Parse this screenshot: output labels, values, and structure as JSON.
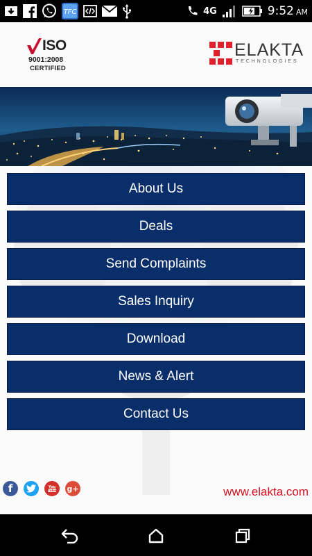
{
  "status_bar": {
    "time": "9:52",
    "ampm": "AM",
    "network": "4G",
    "left_icons": [
      "download-icon",
      "facebook-icon",
      "whatsapp-icon",
      "tfc-app-icon",
      "code-icon",
      "mail-icon",
      "usb-icon"
    ],
    "right_icons": [
      "phone-icon",
      "signal-icon",
      "battery-icon"
    ]
  },
  "header": {
    "iso_logo": {
      "word": "ISO",
      "standard": "9001:2008",
      "certified": "CERTIFIED"
    },
    "brand_logo": {
      "name": "ELAKTA",
      "tagline": "TECHNOLOGIES"
    }
  },
  "banner": {
    "icons": [
      "city-night-image",
      "cctv-camera-image"
    ]
  },
  "menu": {
    "items": [
      {
        "label": "About Us"
      },
      {
        "label": "Deals"
      },
      {
        "label": "Send Complaints"
      },
      {
        "label": "Sales Inquiry"
      },
      {
        "label": "Download"
      },
      {
        "label": "News & Alert"
      },
      {
        "label": "Contact Us"
      }
    ]
  },
  "footer": {
    "social_icons": [
      "facebook-icon",
      "twitter-icon",
      "youtube-icon",
      "google-plus-icon"
    ],
    "website": "www.elakta.com"
  },
  "nav_bar": {
    "buttons": [
      "back-icon",
      "home-icon",
      "recents-icon"
    ]
  },
  "colors": {
    "button_bg": "#0a2e6a",
    "link_red": "#d4101e",
    "brand_red": "#e0202a"
  }
}
